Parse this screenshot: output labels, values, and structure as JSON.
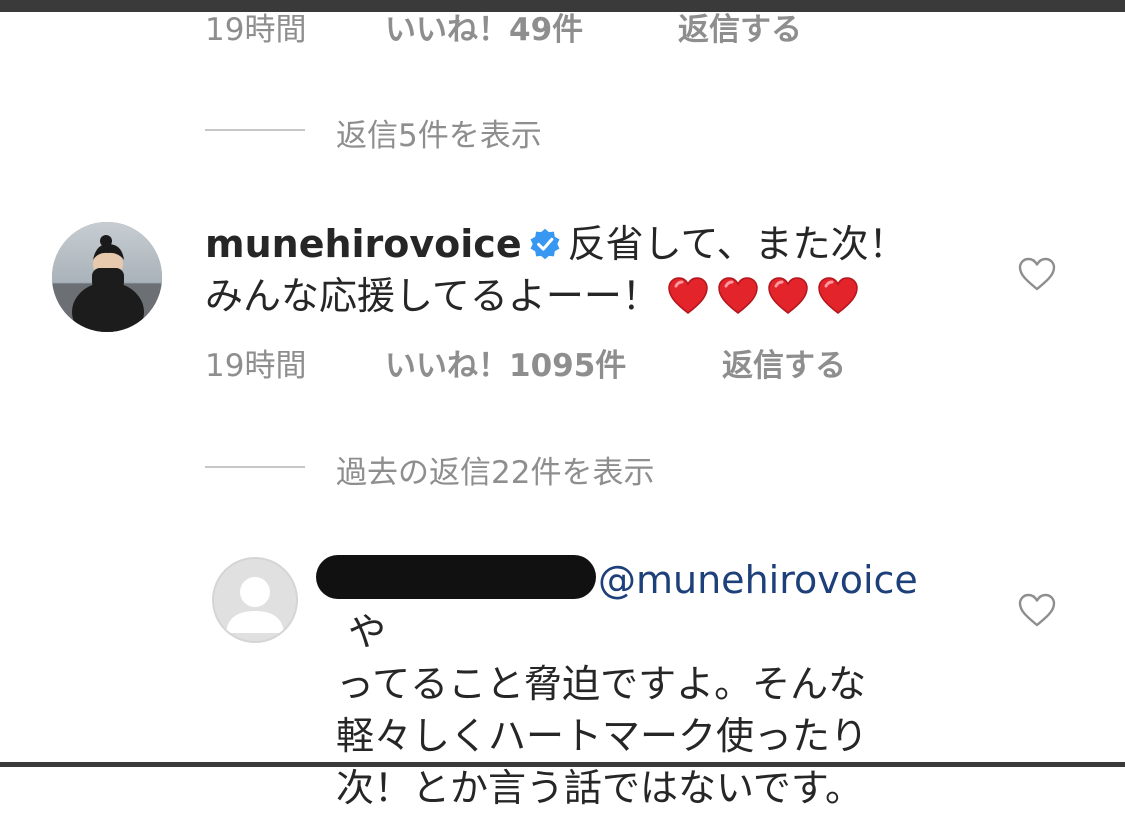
{
  "prev_comment": {
    "time": "19時間",
    "likes": "いいね！49件",
    "reply": "返信する",
    "view_replies": "返信5件を表示"
  },
  "main_comment": {
    "username": "munehirovoice",
    "line1": "反省して、また次！",
    "line2": "みんな応援してるよーー！",
    "hearts": 4,
    "time": "19時間",
    "likes": "いいね！1095件",
    "reply": "返信する",
    "view_past_replies": "過去の返信22件を表示"
  },
  "reply_comment": {
    "mention": "@munehirovoice",
    "line1_tail": "や",
    "line2": "ってること脅迫ですよ。そんな",
    "line3": "軽々しくハートマーク使ったり",
    "line4": "次！とか言う話ではないです。"
  },
  "icons": {
    "verified": "verified-badge-icon",
    "heart_emoji": "red-heart-emoji",
    "like": "heart-outline-icon"
  },
  "colors": {
    "meta_gray": "#8e8e8e",
    "text": "#262626",
    "verified_blue": "#3897f0",
    "heart_red": "#e3242b",
    "mention_blue": "#1d3f7a"
  }
}
